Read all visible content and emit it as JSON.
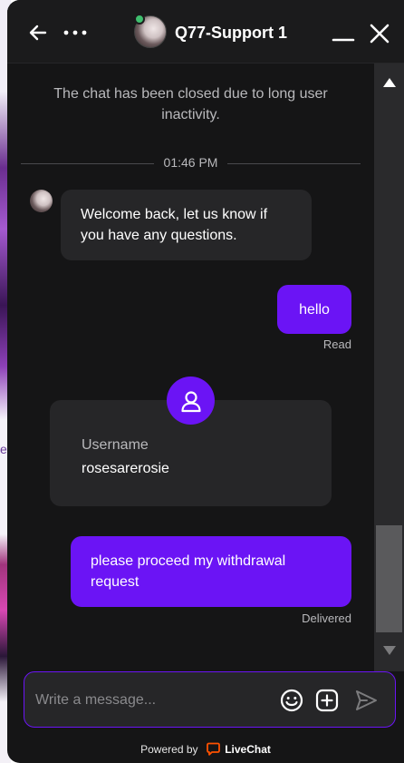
{
  "header": {
    "agent_name": "Q77-Support 1"
  },
  "messages": {
    "system_note": "The chat has been closed due to long user inactivity.",
    "time_divider": "01:46 PM",
    "agent_greeting": "Welcome back, let us know if you have any questions.",
    "user_hello": "hello",
    "hello_status": "Read",
    "user_card": {
      "label": "Username",
      "value": "rosesarerosie"
    },
    "user_withdraw": "please proceed my withdrawal request",
    "withdraw_status": "Delivered"
  },
  "composer": {
    "placeholder": "Write a message..."
  },
  "footer": {
    "powered_by": "Powered by",
    "brand": "LiveChat"
  },
  "colors": {
    "accent": "#6b14f5",
    "background": "#151516",
    "bubble_agent": "#262628",
    "online": "#3fbf6e",
    "brand_icon": "#ff5100"
  },
  "icons": [
    "back-arrow-icon",
    "more-icon",
    "minimize-icon",
    "close-icon",
    "user-icon",
    "emoji-icon",
    "attach-icon",
    "send-icon",
    "livechat-logo-icon"
  ]
}
